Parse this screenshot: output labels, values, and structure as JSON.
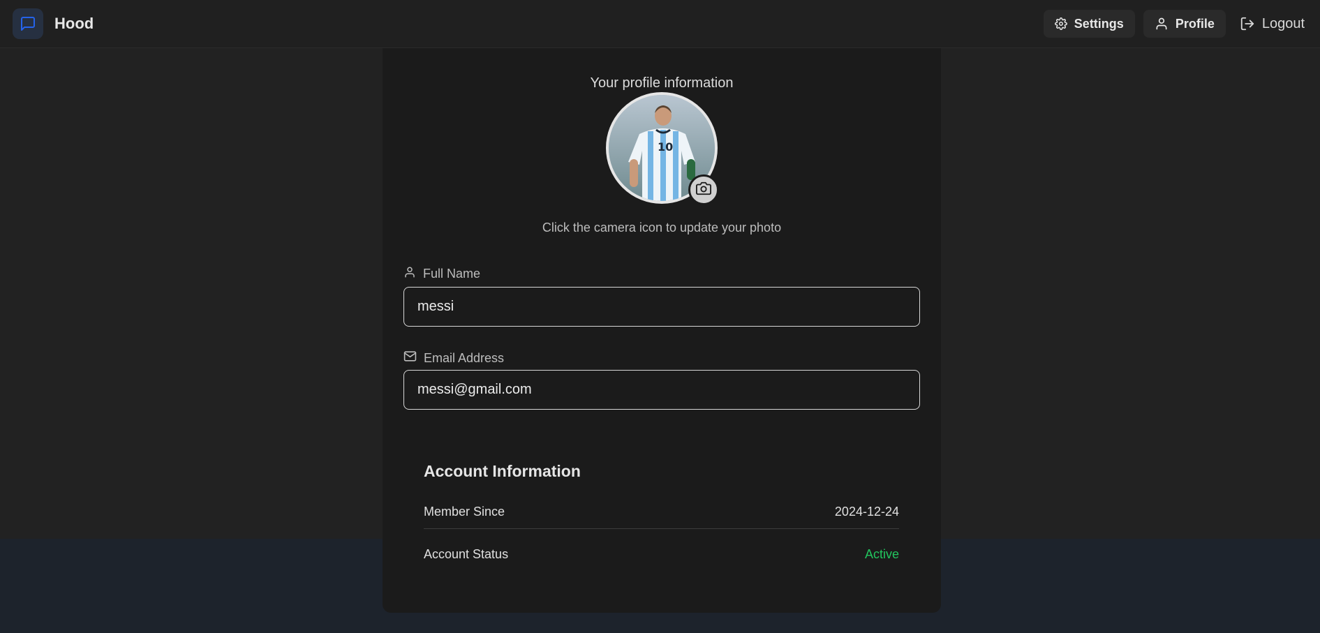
{
  "app": {
    "name": "Hood",
    "logo_icon": "message-square-icon",
    "accent": "#2563eb"
  },
  "nav": {
    "settings_label": "Settings",
    "profile_label": "Profile",
    "logout_label": "Logout"
  },
  "profile": {
    "subtitle": "Your profile information",
    "photo_hint": "Click the camera icon to update your photo",
    "full_name": {
      "label": "Full Name",
      "value": "messi"
    },
    "email": {
      "label": "Email Address",
      "value": "messi@gmail.com"
    }
  },
  "account": {
    "title": "Account Information",
    "member_since_label": "Member Since",
    "member_since_value": "2024-12-24",
    "status_label": "Account Status",
    "status_value": "Active",
    "status_color": "#22c55e"
  }
}
